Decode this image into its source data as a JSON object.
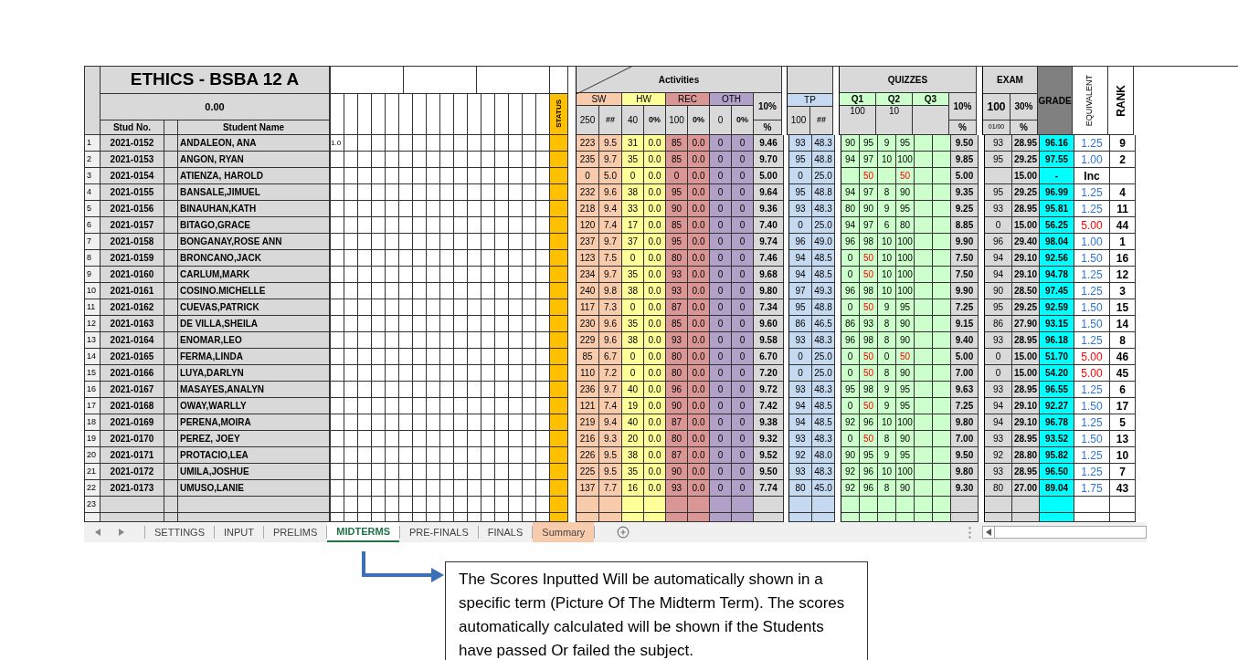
{
  "sheet": {
    "title": "ETHICS  - BSBA 12 A",
    "subtitle": "0.00",
    "stud_no_header": "Stud No.",
    "name_header": "Student Name",
    "status_header": "STATUS",
    "activities": {
      "title": "Activities",
      "groups": [
        {
          "label": "SW",
          "max": "250",
          "pct": "##",
          "color": "#f8cbad"
        },
        {
          "label": "HW",
          "max": "40",
          "pct": "0%",
          "color": "#ffff99"
        },
        {
          "label": "REC",
          "max": "100",
          "pct": "0%",
          "color": "#da9694"
        },
        {
          "label": "OTH",
          "max": "0",
          "pct": "0%",
          "color": "#b1a0c7"
        }
      ],
      "weight": "10%",
      "unit": "%"
    },
    "tp": {
      "label": "TP",
      "max": "100",
      "pct": "##"
    },
    "quizzes": {
      "title": "QUIZZES",
      "items": [
        {
          "label": "Q1",
          "max": "100"
        },
        {
          "label": "Q2",
          "max": "10"
        },
        {
          "label": "Q3"
        }
      ],
      "weight": "10%",
      "unit": "%"
    },
    "exam": {
      "title": "EXAM",
      "max": "100",
      "weight": "30%",
      "sub_max": "01/00",
      "unit": "%"
    },
    "grade_header": "GRADE",
    "equivalent_header": "EQUIVALENT",
    "rank_header": "RANK"
  },
  "rows": [
    {
      "number": "1",
      "stud_no": "2021-0152",
      "name": "ANDALEON, ANA",
      "extra": "1.0",
      "sw": [
        "223",
        "9.5"
      ],
      "hw": [
        "31",
        "0.0"
      ],
      "rec": [
        "85",
        "0.0"
      ],
      "oth": [
        "0",
        "0"
      ],
      "act_pct": "9.46",
      "tp": [
        "93",
        "48.3"
      ],
      "q1": {
        "score": "90",
        "pct": "95",
        "failed": false
      },
      "q2": {
        "score": "9",
        "pct": "95",
        "failed": false
      },
      "quiz_pct": "9.50",
      "exam_score": "93",
      "exam_pct": "28.95",
      "grade": "96.16",
      "equivalent": {
        "text": "1.25",
        "color": "#2e75d6"
      },
      "rank": "9"
    },
    {
      "number": "2",
      "stud_no": "2021-0153",
      "name": "ANGON, RYAN",
      "sw": [
        "235",
        "9.7"
      ],
      "hw": [
        "35",
        "0.0"
      ],
      "rec": [
        "85",
        "0.0"
      ],
      "oth": [
        "0",
        "0"
      ],
      "act_pct": "9.70",
      "tp": [
        "95",
        "48.8"
      ],
      "q1": {
        "score": "94",
        "pct": "97",
        "failed": false
      },
      "q2": {
        "score": "10",
        "pct": "100",
        "failed": false
      },
      "quiz_pct": "9.85",
      "exam_score": "95",
      "exam_pct": "29.25",
      "grade": "97.55",
      "equivalent": {
        "text": "1.00",
        "color": "#2e75d6"
      },
      "rank": "2"
    },
    {
      "number": "3",
      "stud_no": "2021-0154",
      "name": "ATIENZA, HAROLD",
      "sw": [
        "0",
        "5.0"
      ],
      "hw": [
        "0",
        "0.0"
      ],
      "rec": [
        "0",
        "0.0"
      ],
      "oth": [
        "0",
        "0"
      ],
      "act_pct": "5.00",
      "tp": [
        "0",
        "25.0"
      ],
      "q1": {
        "pct": "50",
        "failed": true
      },
      "q2": {
        "pct": "50",
        "failed": true
      },
      "quiz_pct": "5.00",
      "exam_pct": "15.00",
      "grade": "-",
      "equivalent": {
        "text": "Inc",
        "color": "#000000"
      }
    },
    {
      "number": "4",
      "stud_no": "2021-0155",
      "name": "BANSALE,JIMUEL",
      "sw": [
        "232",
        "9.6"
      ],
      "hw": [
        "38",
        "0.0"
      ],
      "rec": [
        "95",
        "0.0"
      ],
      "oth": [
        "0",
        "0"
      ],
      "act_pct": "9.64",
      "tp": [
        "95",
        "48.8"
      ],
      "q1": {
        "score": "94",
        "pct": "97",
        "failed": false
      },
      "q2": {
        "score": "8",
        "pct": "90",
        "failed": false
      },
      "quiz_pct": "9.35",
      "exam_score": "95",
      "exam_pct": "29.25",
      "grade": "96.99",
      "equivalent": {
        "text": "1.25",
        "color": "#2e75d6"
      },
      "rank": "4"
    },
    {
      "number": "5",
      "stud_no": "2021-0156",
      "name": "BINAUHAN,KATH",
      "sw": [
        "218",
        "9.4"
      ],
      "hw": [
        "33",
        "0.0"
      ],
      "rec": [
        "90",
        "0.0"
      ],
      "oth": [
        "0",
        "0"
      ],
      "act_pct": "9.36",
      "tp": [
        "93",
        "48.3"
      ],
      "q1": {
        "score": "80",
        "pct": "90",
        "failed": false
      },
      "q2": {
        "score": "9",
        "pct": "95",
        "failed": false
      },
      "quiz_pct": "9.25",
      "exam_score": "93",
      "exam_pct": "28.95",
      "grade": "95.81",
      "equivalent": {
        "text": "1.25",
        "color": "#2e75d6"
      },
      "rank": "11"
    },
    {
      "number": "6",
      "stud_no": "2021-0157",
      "name": "BITAGO,GRACE",
      "sw": [
        "120",
        "7.4"
      ],
      "hw": [
        "17",
        "0.0"
      ],
      "rec": [
        "85",
        "0.0"
      ],
      "oth": [
        "0",
        "0"
      ],
      "act_pct": "7.40",
      "tp": [
        "0",
        "25.0"
      ],
      "q1": {
        "score": "94",
        "pct": "97",
        "failed": false
      },
      "q2": {
        "score": "6",
        "pct": "80",
        "failed": false
      },
      "quiz_pct": "8.85",
      "exam_score": "0",
      "exam_pct": "15.00",
      "grade": "56.25",
      "equivalent": {
        "text": "5.00",
        "color": "#ff0000"
      },
      "rank": "44"
    },
    {
      "number": "7",
      "stud_no": "2021-0158",
      "name": "BONGANAY,ROSE ANN",
      "sw": [
        "237",
        "9.7"
      ],
      "hw": [
        "37",
        "0.0"
      ],
      "rec": [
        "95",
        "0.0"
      ],
      "oth": [
        "0",
        "0"
      ],
      "act_pct": "9.74",
      "tp": [
        "96",
        "49.0"
      ],
      "q1": {
        "score": "96",
        "pct": "98",
        "failed": false
      },
      "q2": {
        "score": "10",
        "pct": "100",
        "failed": false
      },
      "quiz_pct": "9.90",
      "exam_score": "96",
      "exam_pct": "29.40",
      "grade": "98.04",
      "equivalent": {
        "text": "1.00",
        "color": "#2e75d6"
      },
      "rank": "1"
    },
    {
      "number": "8",
      "stud_no": "2021-0159",
      "name": "BRONCANO,JACK",
      "sw": [
        "123",
        "7.5"
      ],
      "hw": [
        "0",
        "0.0"
      ],
      "rec": [
        "80",
        "0.0"
      ],
      "oth": [
        "0",
        "0"
      ],
      "act_pct": "7.46",
      "tp": [
        "94",
        "48.5"
      ],
      "q1": {
        "score": "0",
        "pct": "50",
        "failed": true
      },
      "q2": {
        "score": "10",
        "pct": "100",
        "failed": false
      },
      "quiz_pct": "7.50",
      "exam_score": "94",
      "exam_pct": "29.10",
      "grade": "92.56",
      "equivalent": {
        "text": "1.50",
        "color": "#2e75d6"
      },
      "rank": "16"
    },
    {
      "number": "9",
      "stud_no": "2021-0160",
      "name": "CARLUM,MARK",
      "sw": [
        "234",
        "9.7"
      ],
      "hw": [
        "35",
        "0.0"
      ],
      "rec": [
        "93",
        "0.0"
      ],
      "oth": [
        "0",
        "0"
      ],
      "act_pct": "9.68",
      "tp": [
        "94",
        "48.5"
      ],
      "q1": {
        "score": "0",
        "pct": "50",
        "failed": true
      },
      "q2": {
        "score": "10",
        "pct": "100",
        "failed": false
      },
      "quiz_pct": "7.50",
      "exam_score": "94",
      "exam_pct": "29.10",
      "grade": "94.78",
      "equivalent": {
        "text": "1.25",
        "color": "#2e75d6"
      },
      "rank": "12"
    },
    {
      "number": "10",
      "stud_no": "2021-0161",
      "name": "COSINO.MICHELLE",
      "sw": [
        "240",
        "9.8"
      ],
      "hw": [
        "38",
        "0.0"
      ],
      "rec": [
        "93",
        "0.0"
      ],
      "oth": [
        "0",
        "0"
      ],
      "act_pct": "9.80",
      "tp": [
        "97",
        "49.3"
      ],
      "q1": {
        "score": "96",
        "pct": "98",
        "failed": false
      },
      "q2": {
        "score": "10",
        "pct": "100",
        "failed": false
      },
      "quiz_pct": "9.90",
      "exam_score": "90",
      "exam_pct": "28.50",
      "grade": "97.45",
      "equivalent": {
        "text": "1.25",
        "color": "#2e75d6"
      },
      "rank": "3"
    },
    {
      "number": "11",
      "stud_no": "2021-0162",
      "name": "CUEVAS,PATRICK",
      "sw": [
        "117",
        "7.3"
      ],
      "hw": [
        "0",
        "0.0"
      ],
      "rec": [
        "87",
        "0.0"
      ],
      "oth": [
        "0",
        "0"
      ],
      "act_pct": "7.34",
      "tp": [
        "95",
        "48.8"
      ],
      "q1": {
        "score": "0",
        "pct": "50",
        "failed": true
      },
      "q2": {
        "score": "9",
        "pct": "95",
        "failed": false
      },
      "quiz_pct": "7.25",
      "exam_score": "95",
      "exam_pct": "29.25",
      "grade": "92.59",
      "equivalent": {
        "text": "1.50",
        "color": "#2e75d6"
      },
      "rank": "15"
    },
    {
      "number": "12",
      "stud_no": "2021-0163",
      "name": "DE VILLA,SHEILA",
      "sw": [
        "230",
        "9.6"
      ],
      "hw": [
        "35",
        "0.0"
      ],
      "rec": [
        "85",
        "0.0"
      ],
      "oth": [
        "0",
        "0"
      ],
      "act_pct": "9.60",
      "tp": [
        "86",
        "46.5"
      ],
      "q1": {
        "score": "86",
        "pct": "93",
        "failed": false
      },
      "q2": {
        "score": "8",
        "pct": "90",
        "failed": false
      },
      "quiz_pct": "9.15",
      "exam_score": "86",
      "exam_pct": "27.90",
      "grade": "93.15",
      "equivalent": {
        "text": "1.50",
        "color": "#2e75d6"
      },
      "rank": "14"
    },
    {
      "number": "13",
      "stud_no": "2021-0164",
      "name": "ENOMAR,LEO",
      "sw": [
        "229",
        "9.6"
      ],
      "hw": [
        "38",
        "0.0"
      ],
      "rec": [
        "93",
        "0.0"
      ],
      "oth": [
        "0",
        "0"
      ],
      "act_pct": "9.58",
      "tp": [
        "93",
        "48.3"
      ],
      "q1": {
        "score": "96",
        "pct": "98",
        "failed": false
      },
      "q2": {
        "score": "8",
        "pct": "90",
        "failed": false
      },
      "quiz_pct": "9.40",
      "exam_score": "93",
      "exam_pct": "28.95",
      "grade": "96.18",
      "equivalent": {
        "text": "1.25",
        "color": "#2e75d6"
      },
      "rank": "8"
    },
    {
      "number": "14",
      "stud_no": "2021-0165",
      "name": "FERMA,LINDA",
      "sw": [
        "85",
        "6.7"
      ],
      "hw": [
        "0",
        "0.0"
      ],
      "rec": [
        "80",
        "0.0"
      ],
      "oth": [
        "0",
        "0"
      ],
      "act_pct": "6.70",
      "tp": [
        "0",
        "25.0"
      ],
      "q1": {
        "score": "0",
        "pct": "50",
        "failed": true
      },
      "q2": {
        "score": "0",
        "pct": "50",
        "failed": true
      },
      "quiz_pct": "5.00",
      "exam_score": "0",
      "exam_pct": "15.00",
      "grade": "51.70",
      "equivalent": {
        "text": "5.00",
        "color": "#ff0000"
      },
      "rank": "46"
    },
    {
      "number": "15",
      "stud_no": "2021-0166",
      "name": "LUYA,DARLYN",
      "sw": [
        "110",
        "7.2"
      ],
      "hw": [
        "0",
        "0.0"
      ],
      "rec": [
        "80",
        "0.0"
      ],
      "oth": [
        "0",
        "0"
      ],
      "act_pct": "7.20",
      "tp": [
        "0",
        "25.0"
      ],
      "q1": {
        "score": "0",
        "pct": "50",
        "failed": true
      },
      "q2": {
        "score": "8",
        "pct": "90",
        "failed": false
      },
      "quiz_pct": "7.00",
      "exam_score": "0",
      "exam_pct": "15.00",
      "grade": "54.20",
      "equivalent": {
        "text": "5.00",
        "color": "#ff0000"
      },
      "rank": "45"
    },
    {
      "number": "16",
      "stud_no": "2021-0167",
      "name": "MASAYES,ANALYN",
      "sw": [
        "236",
        "9.7"
      ],
      "hw": [
        "40",
        "0.0"
      ],
      "rec": [
        "96",
        "0.0"
      ],
      "oth": [
        "0",
        "0"
      ],
      "act_pct": "9.72",
      "tp": [
        "93",
        "48.3"
      ],
      "q1": {
        "score": "95",
        "pct": "98",
        "failed": false
      },
      "q2": {
        "score": "9",
        "pct": "95",
        "failed": false
      },
      "quiz_pct": "9.63",
      "exam_score": "93",
      "exam_pct": "28.95",
      "grade": "96.55",
      "equivalent": {
        "text": "1.25",
        "color": "#2e75d6"
      },
      "rank": "6"
    },
    {
      "number": "17",
      "stud_no": "2021-0168",
      "name": "OWAY,WARLLY",
      "sw": [
        "121",
        "7.4"
      ],
      "hw": [
        "19",
        "0.0"
      ],
      "rec": [
        "90",
        "0.0"
      ],
      "oth": [
        "0",
        "0"
      ],
      "act_pct": "7.42",
      "tp": [
        "94",
        "48.5"
      ],
      "q1": {
        "score": "0",
        "pct": "50",
        "failed": true
      },
      "q2": {
        "score": "9",
        "pct": "95",
        "failed": false
      },
      "quiz_pct": "7.25",
      "exam_score": "94",
      "exam_pct": "29.10",
      "grade": "92.27",
      "equivalent": {
        "text": "1.50",
        "color": "#2e75d6"
      },
      "rank": "17"
    },
    {
      "number": "18",
      "stud_no": "2021-0169",
      "name": "PERENA,MOIRA",
      "sw": [
        "219",
        "9.4"
      ],
      "hw": [
        "40",
        "0.0"
      ],
      "rec": [
        "87",
        "0.0"
      ],
      "oth": [
        "0",
        "0"
      ],
      "act_pct": "9.38",
      "tp": [
        "94",
        "48.5"
      ],
      "q1": {
        "score": "92",
        "pct": "96",
        "failed": false
      },
      "q2": {
        "score": "10",
        "pct": "100",
        "failed": false
      },
      "quiz_pct": "9.80",
      "exam_score": "94",
      "exam_pct": "29.10",
      "grade": "96.78",
      "equivalent": {
        "text": "1.25",
        "color": "#2e75d6"
      },
      "rank": "5"
    },
    {
      "number": "19",
      "stud_no": "2021-0170",
      "name": "PEREZ, JOEY",
      "sw": [
        "216",
        "9.3"
      ],
      "hw": [
        "20",
        "0.0"
      ],
      "rec": [
        "80",
        "0.0"
      ],
      "oth": [
        "0",
        "0"
      ],
      "act_pct": "9.32",
      "tp": [
        "93",
        "48.3"
      ],
      "q1": {
        "score": "0",
        "pct": "50",
        "failed": true
      },
      "q2": {
        "score": "8",
        "pct": "90",
        "failed": false
      },
      "quiz_pct": "7.00",
      "exam_score": "93",
      "exam_pct": "28.95",
      "grade": "93.52",
      "equivalent": {
        "text": "1.50",
        "color": "#2e75d6"
      },
      "rank": "13"
    },
    {
      "number": "20",
      "stud_no": "2021-0171",
      "name": "PROTACIO,LEA",
      "sw": [
        "226",
        "9.5"
      ],
      "hw": [
        "38",
        "0.0"
      ],
      "rec": [
        "87",
        "0.0"
      ],
      "oth": [
        "0",
        "0"
      ],
      "act_pct": "9.52",
      "tp": [
        "92",
        "48.0"
      ],
      "q1": {
        "score": "90",
        "pct": "95",
        "failed": false
      },
      "q2": {
        "score": "9",
        "pct": "95",
        "failed": false
      },
      "quiz_pct": "9.50",
      "exam_score": "92",
      "exam_pct": "28.80",
      "grade": "95.82",
      "equivalent": {
        "text": "1.25",
        "color": "#2e75d6"
      },
      "rank": "10"
    },
    {
      "number": "21",
      "stud_no": "2021-0172",
      "name": "UMILA,JOSHUE",
      "sw": [
        "225",
        "9.5"
      ],
      "hw": [
        "35",
        "0.0"
      ],
      "rec": [
        "90",
        "0.0"
      ],
      "oth": [
        "0",
        "0"
      ],
      "act_pct": "9.50",
      "tp": [
        "93",
        "48.3"
      ],
      "q1": {
        "score": "92",
        "pct": "96",
        "failed": false
      },
      "q2": {
        "score": "10",
        "pct": "100",
        "failed": false
      },
      "quiz_pct": "9.80",
      "exam_score": "93",
      "exam_pct": "28.95",
      "grade": "96.50",
      "equivalent": {
        "text": "1.25",
        "color": "#2e75d6"
      },
      "rank": "7"
    },
    {
      "number": "22",
      "stud_no": "2021-0173",
      "name": "UMUSO,LANIE",
      "sw": [
        "137",
        "7.7"
      ],
      "hw": [
        "16",
        "0.0"
      ],
      "rec": [
        "93",
        "0.0"
      ],
      "oth": [
        "0",
        "0"
      ],
      "act_pct": "7.74",
      "tp": [
        "80",
        "45.0"
      ],
      "q1": {
        "score": "92",
        "pct": "96",
        "failed": false
      },
      "q2": {
        "score": "8",
        "pct": "90",
        "failed": false
      },
      "quiz_pct": "9.30",
      "exam_score": "80",
      "exam_pct": "27.00",
      "grade": "89.04",
      "equivalent": {
        "text": "1.75",
        "color": "#2e75d6"
      },
      "rank": "43"
    }
  ],
  "empty_rows": [
    {
      "number": "23"
    }
  ],
  "tabs": [
    {
      "label": "SETTINGS",
      "selected": false
    },
    {
      "label": "INPUT",
      "selected": false
    },
    {
      "label": "PRELIMS",
      "selected": false
    },
    {
      "label": "MIDTERMS",
      "selected": true
    },
    {
      "label": "PRE-FINALS",
      "selected": false
    },
    {
      "label": "FINALS",
      "selected": false
    },
    {
      "label": "Summary",
      "selected": false,
      "color": "#f8cbad"
    }
  ],
  "note": "The Scores Inputted Will be automatically shown in a specific term (Picture Of The Midterm Term). The scores automatically calculated will be shown if the Students have passed Or failed the subject."
}
